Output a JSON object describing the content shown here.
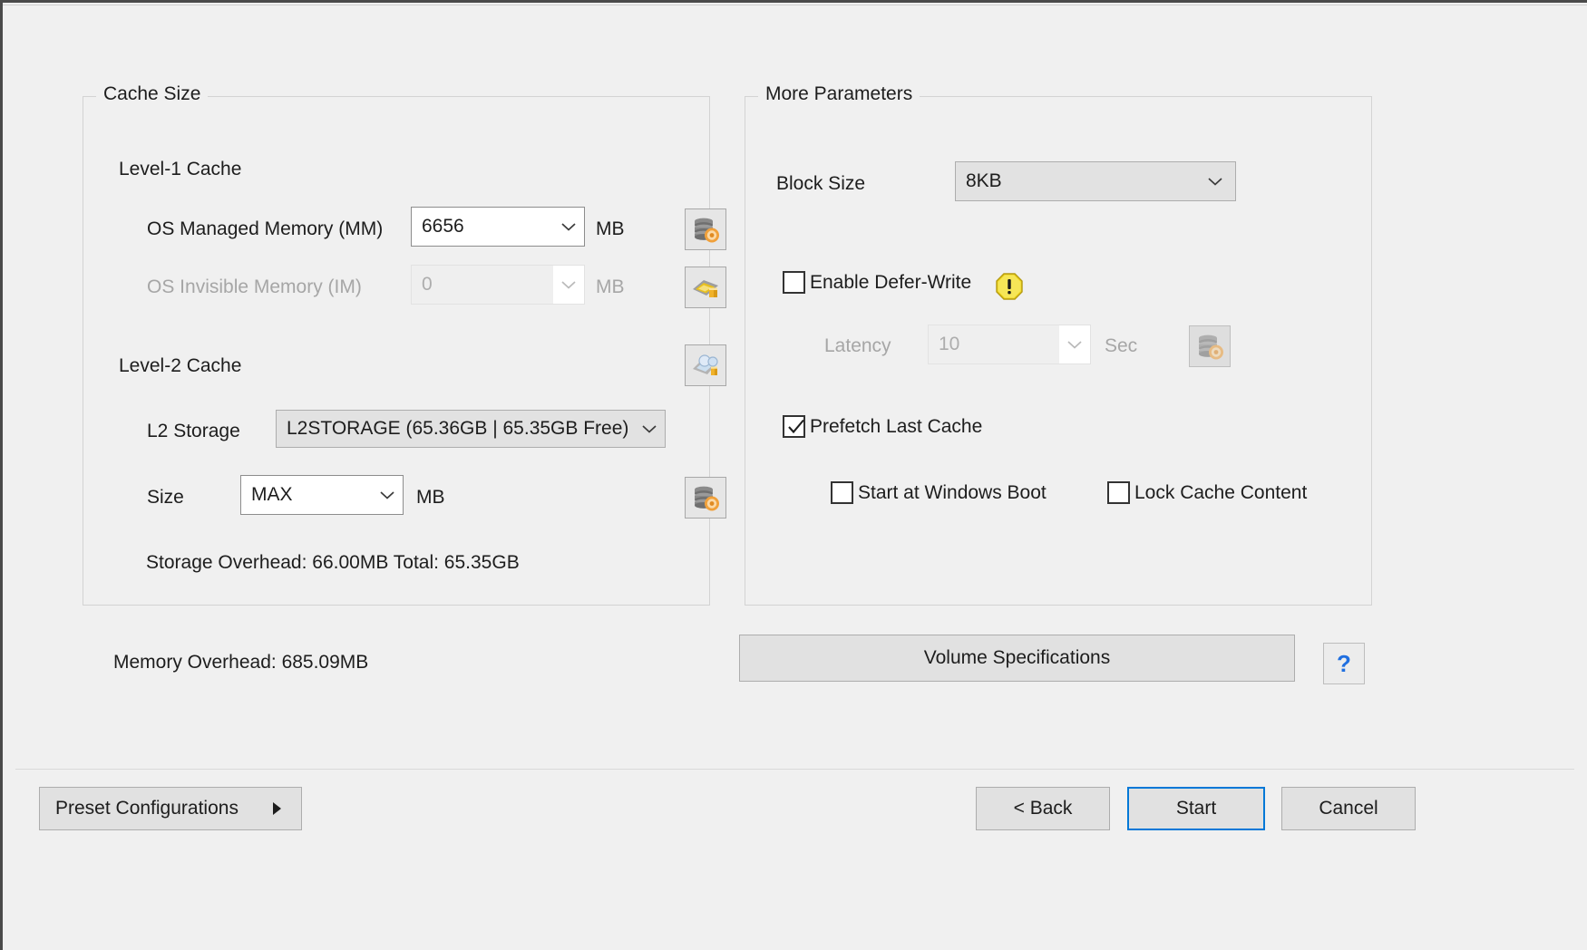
{
  "cache_size": {
    "group_title": "Cache Size",
    "level1": {
      "heading": "Level-1 Cache",
      "mm_label": "OS Managed Memory (MM)",
      "mm_value": "6656",
      "mm_unit": "MB",
      "mm_icon": "database-gear-icon",
      "im_label": "OS Invisible Memory (IM)",
      "im_value": "0",
      "im_unit": "MB",
      "im_icon": "memory-module-icon"
    },
    "level2": {
      "heading": "Level-2 Cache",
      "heading_icon": "disk-search-icon",
      "storage_label": "L2 Storage",
      "storage_value": "L2STORAGE (65.36GB | 65.35GB Free)",
      "size_label": "Size",
      "size_value": "MAX",
      "size_unit": "MB",
      "size_icon": "database-gear-icon"
    },
    "overhead_line": "Storage Overhead: 66.00MB    Total: 65.35GB"
  },
  "more_parameters": {
    "group_title": "More Parameters",
    "block_size_label": "Block Size",
    "block_size_value": "8KB",
    "defer_write_label": "Enable Defer-Write",
    "defer_write_checked": false,
    "defer_write_warning_icon": "warning-icon",
    "latency_label": "Latency",
    "latency_value": "10",
    "latency_unit": "Sec",
    "latency_icon": "database-gear-icon",
    "prefetch_label": "Prefetch Last Cache",
    "prefetch_checked": true,
    "start_boot_label": "Start at Windows Boot",
    "start_boot_checked": false,
    "lock_cache_label": "Lock Cache Content",
    "lock_cache_checked": false
  },
  "memory_overhead": "Memory Overhead: 685.09MB",
  "volume_specs_label": "Volume Specifications",
  "help_label": "?",
  "help_icon": "question-mark-icon",
  "footer": {
    "preset_label": "Preset Configurations",
    "preset_arrow_icon": "caret-right-icon",
    "back_label": "< Back",
    "start_label": "Start",
    "cancel_label": "Cancel"
  },
  "colors": {
    "accent": "#0078d7",
    "warning": "#e8d22a",
    "help_blue": "#1f6fe0",
    "window_bg": "#f0f0f0"
  }
}
